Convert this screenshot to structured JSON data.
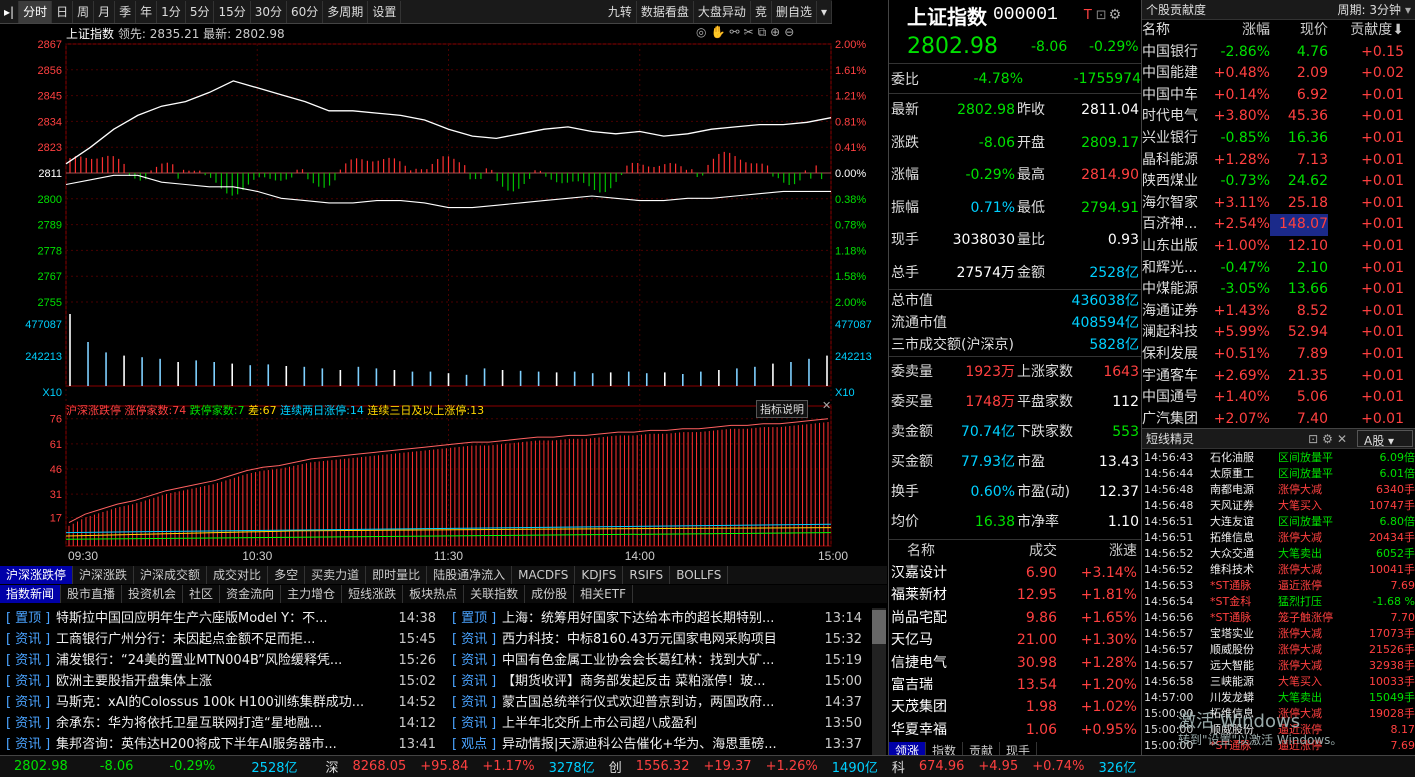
{
  "toolbar": {
    "left": [
      "分时",
      "日",
      "周",
      "月",
      "季",
      "年",
      "1分",
      "5分",
      "15分",
      "30分",
      "60分",
      "多周期",
      "设置"
    ],
    "right": [
      "九转",
      "数据看盘",
      "大盘异动",
      "竞",
      "删自选"
    ]
  },
  "chart_header": {
    "name": "上证指数",
    "lead_label": "领先:",
    "lead_value": "2835.21",
    "last_label": "最新:",
    "last_value": "2802.98"
  },
  "chart_data": [
    {
      "type": "line",
      "title": "上证指数 分时",
      "prev_close": 2811.04,
      "ylim": [
        2755,
        2867
      ],
      "y_ticks_left": [
        "2867",
        "2856",
        "2845",
        "2834",
        "2823",
        "2811",
        "2800",
        "2789",
        "2778",
        "2767",
        "2755"
      ],
      "y_ticks_right": [
        "2.00%",
        "1.61%",
        "1.21%",
        "0.81%",
        "0.41%",
        "0.00%",
        "0.38%",
        "0.78%",
        "1.18%",
        "1.58%",
        "2.00%"
      ],
      "x_ticks": [
        "09:30",
        "10:30",
        "11:30",
        "14:00",
        "15:00"
      ],
      "series": [
        {
          "name": "领先",
          "values": [
            2815,
            2822,
            2830,
            2836,
            2840,
            2842,
            2846,
            2851,
            2848,
            2845,
            2842,
            2838,
            2838,
            2837,
            2836,
            2834,
            2830,
            2827,
            2826,
            2828,
            2830,
            2831,
            2829,
            2828,
            2829,
            2827,
            2828,
            2830,
            2831,
            2832,
            2832,
            2833,
            2835
          ]
        },
        {
          "name": "最新",
          "values": [
            2806,
            2808,
            2810,
            2810,
            2807,
            2806,
            2805,
            2805,
            2803,
            2800,
            2799,
            2798,
            2798,
            2799,
            2799,
            2798,
            2796,
            2796,
            2797,
            2798,
            2799,
            2800,
            2801,
            2800,
            2799,
            2799,
            2800,
            2800,
            2801,
            2802,
            2803,
            2803,
            2803
          ]
        }
      ]
    },
    {
      "type": "bar",
      "title": "成交量",
      "y_ticks": [
        "477087",
        "242213"
      ],
      "x_label": "X10",
      "values": [
        90,
        55,
        42,
        38,
        36,
        34,
        30,
        32,
        30,
        28,
        26,
        27,
        25,
        24,
        22,
        20,
        24,
        22,
        20,
        18,
        18,
        16,
        14,
        22,
        20,
        19,
        18,
        17,
        18,
        16,
        17,
        18,
        16,
        17,
        15,
        18,
        20,
        22,
        24,
        28,
        30,
        34,
        38
      ]
    },
    {
      "type": "bar",
      "title": "沪深涨跌停",
      "y_ticks": [
        "76",
        "61",
        "46",
        "31",
        "17"
      ],
      "values": [
        12,
        17,
        20,
        23,
        25,
        28,
        31,
        33,
        35,
        37,
        40,
        43,
        45,
        46,
        48,
        50,
        51,
        52,
        53,
        54,
        55,
        56,
        57,
        58,
        59,
        60,
        60,
        61,
        62,
        63,
        63,
        64,
        64,
        65,
        66,
        66,
        67,
        67,
        68,
        68,
        69,
        70,
        70,
        71,
        71,
        72,
        73,
        74
      ]
    }
  ],
  "limit_bar": {
    "title": "沪深涨跌停",
    "zt_label": "涨停家数:",
    "zt_value": "74",
    "dt_label": "跌停家数:",
    "dt_value": "7",
    "diff_label": "差:",
    "diff_value": "67",
    "lb2_label": "连续两日涨停:",
    "lb2_value": "14",
    "lb3_label": "连续三日及以上涨停:",
    "lb3_value": "13",
    "help": "指标说明"
  },
  "indicator_tabs": [
    "沪深涨跌停",
    "沪深涨跌",
    "沪深成交额",
    "成交对比",
    "多空",
    "买卖力道",
    "即时量比",
    "陆股通净流入",
    "MACDFS",
    "KDJFS",
    "RSIFS",
    "BOLLFS"
  ],
  "news_tabs": [
    "指数新闻",
    "股市直播",
    "投资机会",
    "社区",
    "资金流向",
    "主力增仓",
    "短线涨跌",
    "板块热点",
    "关联指数",
    "成份股",
    "相关ETF"
  ],
  "news_left": [
    {
      "tag": "置顶",
      "text": "特斯拉中国回应明年生产六座版Model Y：不...",
      "time": "14:38"
    },
    {
      "tag": "资讯",
      "text": "工商银行广州分行：未因起点金额不足而拒...",
      "time": "15:45"
    },
    {
      "tag": "资讯",
      "text": "浦发银行：“24美的置业MTN004B”风险缓释凭...",
      "time": "15:26"
    },
    {
      "tag": "资讯",
      "text": "欧洲主要股指开盘集体上涨",
      "time": "15:02"
    },
    {
      "tag": "资讯",
      "text": "马斯克：xAI的Colossus 100k H100训练集群成功...",
      "time": "14:52"
    },
    {
      "tag": "资讯",
      "text": "余承东：华为将依托卫星互联网打造“星地融...",
      "time": "14:12"
    },
    {
      "tag": "资讯",
      "text": "集邦咨询：英伟达H200将成下半年AI服务器市...",
      "time": "13:41"
    }
  ],
  "news_right": [
    {
      "tag": "置顶",
      "text": "上海：统筹用好国家下达给本市的超长期特别...",
      "time": "13:14"
    },
    {
      "tag": "资讯",
      "text": "西力科技：中标8160.43万元国家电网采购项目",
      "time": "15:32"
    },
    {
      "tag": "资讯",
      "text": "中国有色金属工业协会会长葛红林：找到大矿...",
      "time": "15:19"
    },
    {
      "tag": "资讯",
      "text": "【期货收评】商务部发起反击 菜粕涨停！玻...",
      "time": "15:00"
    },
    {
      "tag": "资讯",
      "text": "蒙古国总统举行仪式欢迎普京到访，两国政府...",
      "time": "14:37"
    },
    {
      "tag": "资讯",
      "text": "上半年北交所上市公司超八成盈利",
      "time": "13:50"
    },
    {
      "tag": "观点",
      "text": "异动情报|天源迪科公告催化+华为、海思重磅...",
      "time": "13:37"
    }
  ],
  "index_info": {
    "name": "上证指数",
    "code": "000001",
    "price": "2802.98",
    "change": "-8.06",
    "pct": "-0.29%",
    "weibi_label": "委比",
    "weibi_pct": "-4.78%",
    "weibi_val": "-1755974",
    "rows": [
      {
        "l1": "最新",
        "v1": "2802.98",
        "l2": "昨收",
        "v2": "2811.04"
      },
      {
        "l1": "涨跌",
        "v1": "-8.06",
        "l2": "开盘",
        "v2": "2809.17"
      },
      {
        "l1": "涨幅",
        "v1": "-0.29%",
        "l2": "最高",
        "v2": "2814.90"
      },
      {
        "l1": "振幅",
        "v1": "0.71%",
        "l2": "最低",
        "v2": "2794.91"
      },
      {
        "l1": "现手",
        "v1": "3038030",
        "l2": "量比",
        "v2": "0.93"
      },
      {
        "l1": "总手",
        "v1": "27574万",
        "l2": "金额",
        "v2": "2528亿"
      }
    ],
    "mkt": [
      {
        "l": "总市值",
        "v": "436038亿"
      },
      {
        "l": "流通市值",
        "v": "408594亿"
      },
      {
        "l": "三市成交额(沪深京)",
        "v": "5828亿"
      }
    ],
    "stats": [
      {
        "l1": "委卖量",
        "v1": "1923万",
        "l2": "上涨家数",
        "v2": "1643"
      },
      {
        "l1": "委买量",
        "v1": "1748万",
        "l2": "平盘家数",
        "v2": "112"
      },
      {
        "l1": "卖金额",
        "v1": "70.74亿",
        "l2": "下跌家数",
        "v2": "553"
      },
      {
        "l1": "买金额",
        "v1": "77.93亿",
        "l2": "市盈",
        "v2": "13.43"
      },
      {
        "l1": "换手",
        "v1": "0.60%",
        "l2": "市盈(动)",
        "v2": "12.37"
      },
      {
        "l1": "均价",
        "v1": "16.38",
        "l2": "市净率",
        "v2": "1.10"
      }
    ]
  },
  "rank": {
    "headers": [
      "名称",
      "成交",
      "涨速"
    ],
    "rows": [
      {
        "name": "汉嘉设计",
        "price": "6.90",
        "speed": "+3.14%"
      },
      {
        "name": "福莱新材",
        "price": "12.95",
        "speed": "+1.81%"
      },
      {
        "name": "尚品宅配",
        "price": "9.86",
        "speed": "+1.65%"
      },
      {
        "name": "天亿马",
        "price": "21.00",
        "speed": "+1.30%"
      },
      {
        "name": "信捷电气",
        "price": "30.98",
        "speed": "+1.28%"
      },
      {
        "name": "富吉瑞",
        "price": "13.54",
        "speed": "+1.20%"
      },
      {
        "name": "天茂集团",
        "price": "1.98",
        "speed": "+1.02%"
      },
      {
        "name": "华夏幸福",
        "price": "1.06",
        "speed": "+0.95%"
      }
    ],
    "tabs": [
      "领涨",
      "指数",
      "贡献",
      "现手"
    ]
  },
  "contrib": {
    "title": "个股贡献度",
    "period": "周期: 3分钟",
    "headers": [
      "名称",
      "涨幅",
      "现价",
      "贡献度"
    ],
    "rows": [
      {
        "name": "中国银行",
        "pct": "-2.86%",
        "price": "4.76",
        "c": "+0.15"
      },
      {
        "name": "中国能建",
        "pct": "+0.48%",
        "price": "2.09",
        "c": "+0.02"
      },
      {
        "name": "中国中车",
        "pct": "+0.14%",
        "price": "6.92",
        "c": "+0.01"
      },
      {
        "name": "时代电气",
        "pct": "+3.80%",
        "price": "45.36",
        "c": "+0.01"
      },
      {
        "name": "兴业银行",
        "pct": "-0.85%",
        "price": "16.36",
        "c": "+0.01"
      },
      {
        "name": "晶科能源",
        "pct": "+1.28%",
        "price": "7.13",
        "c": "+0.01"
      },
      {
        "name": "陕西煤业",
        "pct": "-0.73%",
        "price": "24.62",
        "c": "+0.01"
      },
      {
        "name": "海尔智家",
        "pct": "+3.11%",
        "price": "25.18",
        "c": "+0.01"
      },
      {
        "name": "百济神...",
        "pct": "+2.54%",
        "price": "148.07",
        "c": "+0.01"
      },
      {
        "name": "山东出版",
        "pct": "+1.00%",
        "price": "12.10",
        "c": "+0.01"
      },
      {
        "name": "和辉光...",
        "pct": "-0.47%",
        "price": "2.10",
        "c": "+0.01"
      },
      {
        "name": "中煤能源",
        "pct": "-3.05%",
        "price": "13.66",
        "c": "+0.01"
      },
      {
        "name": "海通证券",
        "pct": "+1.43%",
        "price": "8.52",
        "c": "+0.01"
      },
      {
        "name": "澜起科技",
        "pct": "+5.99%",
        "price": "52.94",
        "c": "+0.01"
      },
      {
        "name": "保利发展",
        "pct": "+0.51%",
        "price": "7.89",
        "c": "+0.01"
      },
      {
        "name": "宇通客车",
        "pct": "+2.69%",
        "price": "21.35",
        "c": "+0.01"
      },
      {
        "name": "中国通号",
        "pct": "+1.40%",
        "price": "5.06",
        "c": "+0.01"
      },
      {
        "name": "广汽集团",
        "pct": "+2.07%",
        "price": "7.40",
        "c": "+0.01"
      }
    ]
  },
  "jingling": {
    "title": "短线精灵",
    "market": "A股",
    "rows": [
      {
        "t": "14:56:43",
        "n": "石化油服",
        "e": "区间放量平",
        "v": "6.09倍"
      },
      {
        "t": "14:56:44",
        "n": "太原重工",
        "e": "区间放量平",
        "v": "6.01倍"
      },
      {
        "t": "14:56:48",
        "n": "南都电源",
        "e": "涨停大减",
        "v": "6340手"
      },
      {
        "t": "14:56:48",
        "n": "天风证券",
        "e": "大笔买入",
        "v": "10747手"
      },
      {
        "t": "14:56:51",
        "n": "大连友谊",
        "e": "区间放量平",
        "v": "6.80倍"
      },
      {
        "t": "14:56:51",
        "n": "拓维信息",
        "e": "涨停大减",
        "v": "20434手"
      },
      {
        "t": "14:56:52",
        "n": "大众交通",
        "e": "大笔卖出",
        "v": "6052手"
      },
      {
        "t": "14:56:52",
        "n": "维科技术",
        "e": "涨停大减",
        "v": "10041手"
      },
      {
        "t": "14:56:53",
        "n": "*ST通脉",
        "e": "逼近涨停",
        "v": "7.69"
      },
      {
        "t": "14:56:54",
        "n": "*ST金科",
        "e": "猛烈打压",
        "v": "-1.68 %"
      },
      {
        "t": "14:56:56",
        "n": "*ST通脉",
        "e": "笼子触涨停",
        "v": "7.70"
      },
      {
        "t": "14:56:57",
        "n": "宝塔实业",
        "e": "涨停大减",
        "v": "17073手"
      },
      {
        "t": "14:56:57",
        "n": "顺威股份",
        "e": "涨停大减",
        "v": "21526手"
      },
      {
        "t": "14:56:57",
        "n": "远大智能",
        "e": "涨停大减",
        "v": "32938手"
      },
      {
        "t": "14:56:58",
        "n": "三峡能源",
        "e": "大笔买入",
        "v": "10033手"
      },
      {
        "t": "14:57:00",
        "n": "川发龙蟒",
        "e": "大笔卖出",
        "v": "15049手"
      },
      {
        "t": "15:00:00",
        "n": "拓维信息",
        "e": "涨停大减",
        "v": "19028手"
      },
      {
        "t": "15:00:00",
        "n": "顺威股份",
        "e": "逼近涨停",
        "v": "8.17"
      },
      {
        "t": "15:00:00",
        "n": "*ST通脉",
        "e": "逼近涨停",
        "v": "7.69"
      }
    ],
    "watermark1": "激活 Windows",
    "watermark2": "转到\"设置\"以激活 Windows。"
  },
  "statusbar": {
    "sh_price": "2802.98",
    "sh_chg": "-8.06",
    "sh_pct": "-0.29%",
    "sh_amt": "2528亿",
    "sz_label": "深",
    "sz_price": "8268.05",
    "sz_chg": "+95.84",
    "sz_pct": "+1.17%",
    "sz_amt": "3278亿",
    "cy_label": "创",
    "cy_price": "1556.32",
    "cy_chg": "+19.37",
    "cy_pct": "+1.26%",
    "cy_amt": "1490亿",
    "kc_label": "科",
    "kc_price": "674.96",
    "kc_chg": "+4.95",
    "kc_pct": "+0.74%",
    "kc_amt": "326亿"
  }
}
